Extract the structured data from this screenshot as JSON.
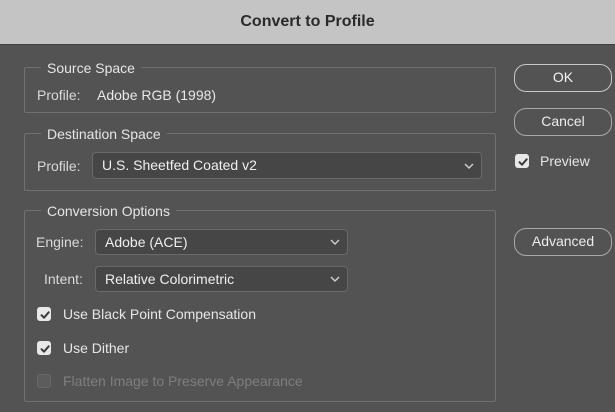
{
  "window": {
    "title": "Convert to Profile"
  },
  "source_space": {
    "legend": "Source Space",
    "profile_label": "Profile:",
    "profile_value": "Adobe RGB (1998)"
  },
  "destination_space": {
    "legend": "Destination Space",
    "profile_label": "Profile:",
    "profile_selected": "U.S. Sheetfed Coated v2"
  },
  "conversion_options": {
    "legend": "Conversion Options",
    "engine_label": "Engine:",
    "engine_selected": "Adobe (ACE)",
    "intent_label": "Intent:",
    "intent_selected": "Relative Colorimetric",
    "black_point": {
      "label": "Use Black Point Compensation",
      "checked": true
    },
    "dither": {
      "label": "Use Dither",
      "checked": true
    },
    "flatten": {
      "label": "Flatten Image to Preserve Appearance",
      "checked": false,
      "disabled": true
    }
  },
  "buttons": {
    "ok": "OK",
    "cancel": "Cancel",
    "advanced": "Advanced"
  },
  "preview": {
    "label": "Preview",
    "checked": true
  },
  "icons": {
    "dropdown": "chevron-down-icon",
    "check": "checkmark-icon"
  },
  "colors": {
    "dialog_bg": "#535353",
    "titlebar_bg": "#c4c4c4",
    "select_bg": "#464646",
    "checkbox_checked": "#e8e8e8"
  }
}
